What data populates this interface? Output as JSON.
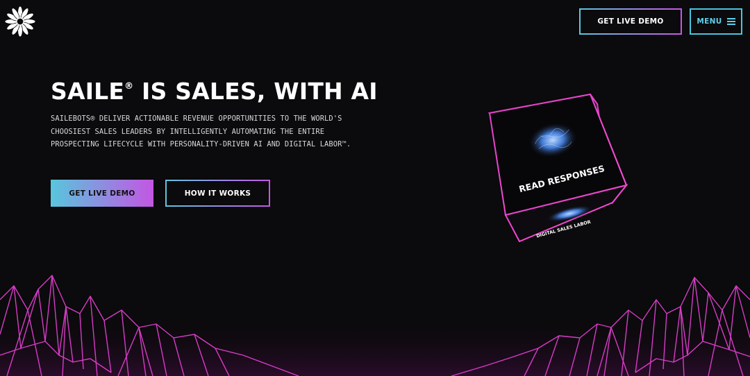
{
  "header": {
    "logo_icon": "flower-logo-icon",
    "demo_label": "GET LIVE DEMO",
    "menu_label": "MENU",
    "menu_icon": "hamburger-icon"
  },
  "hero": {
    "title_main": "SAILE",
    "title_reg": "®",
    "title_rest": " IS SALES, WITH AI",
    "description": "SAILEBOTS® DELIVER ACTIONABLE REVENUE OPPORTUNITIES TO THE WORLD'S CHOOSIEST SALES LEADERS BY INTELLIGENTLY AUTOMATING THE ENTIRE PROSPECTING LIFECYCLE WITH PERSONALITY-DRIVEN AI AND DIGITAL LABOR™.",
    "primary_button": "GET LIVE DEMO",
    "secondary_button": "HOW IT WORKS"
  },
  "cube": {
    "front_label": "READ RESPONSES",
    "bottom_label": "DIGITAL SALES LABOR"
  },
  "colors": {
    "background": "#0b0a0c",
    "accent_cyan": "#5cc8e0",
    "accent_purple": "#c955e8",
    "neon_pink": "#e040c8"
  }
}
